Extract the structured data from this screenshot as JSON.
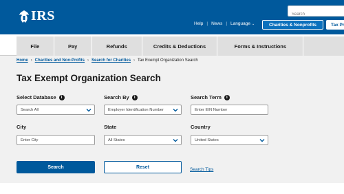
{
  "header": {
    "logo_text": "IRS",
    "search_placeholder": "Search",
    "utility_nav": [
      "Help",
      "News",
      "Language"
    ],
    "charities_button": "Charities & Nonprofits",
    "taxpro_button": "Tax Pro"
  },
  "main_nav": {
    "items": [
      "File",
      "Pay",
      "Refunds",
      "Credits & Deductions",
      "Forms & Instructions"
    ]
  },
  "breadcrumb": {
    "items": [
      "Home",
      "Charities and Non-Profits",
      "Search for Charities"
    ],
    "current": "Tax Exempt Organization Search"
  },
  "page": {
    "title": "Tax Exempt Organization Search"
  },
  "form": {
    "select_database": {
      "label": "Select Database",
      "value": "Search All"
    },
    "search_by": {
      "label": "Search By",
      "value": "Employer Identification Number"
    },
    "search_term": {
      "label": "Search Term",
      "placeholder": "Enter EIN Number"
    },
    "city": {
      "label": "City",
      "placeholder": "Enter City"
    },
    "state": {
      "label": "State",
      "value": "All States"
    },
    "country": {
      "label": "Country",
      "value": "United States"
    },
    "search_button": "Search",
    "reset_button": "Reset",
    "search_tips": "Search Tips"
  },
  "colors": {
    "brand_blue": "#00599c",
    "accent_blue": "#0b70bd",
    "nav_gray": "#dfdfdf",
    "page_bg": "#f1f1f1"
  }
}
